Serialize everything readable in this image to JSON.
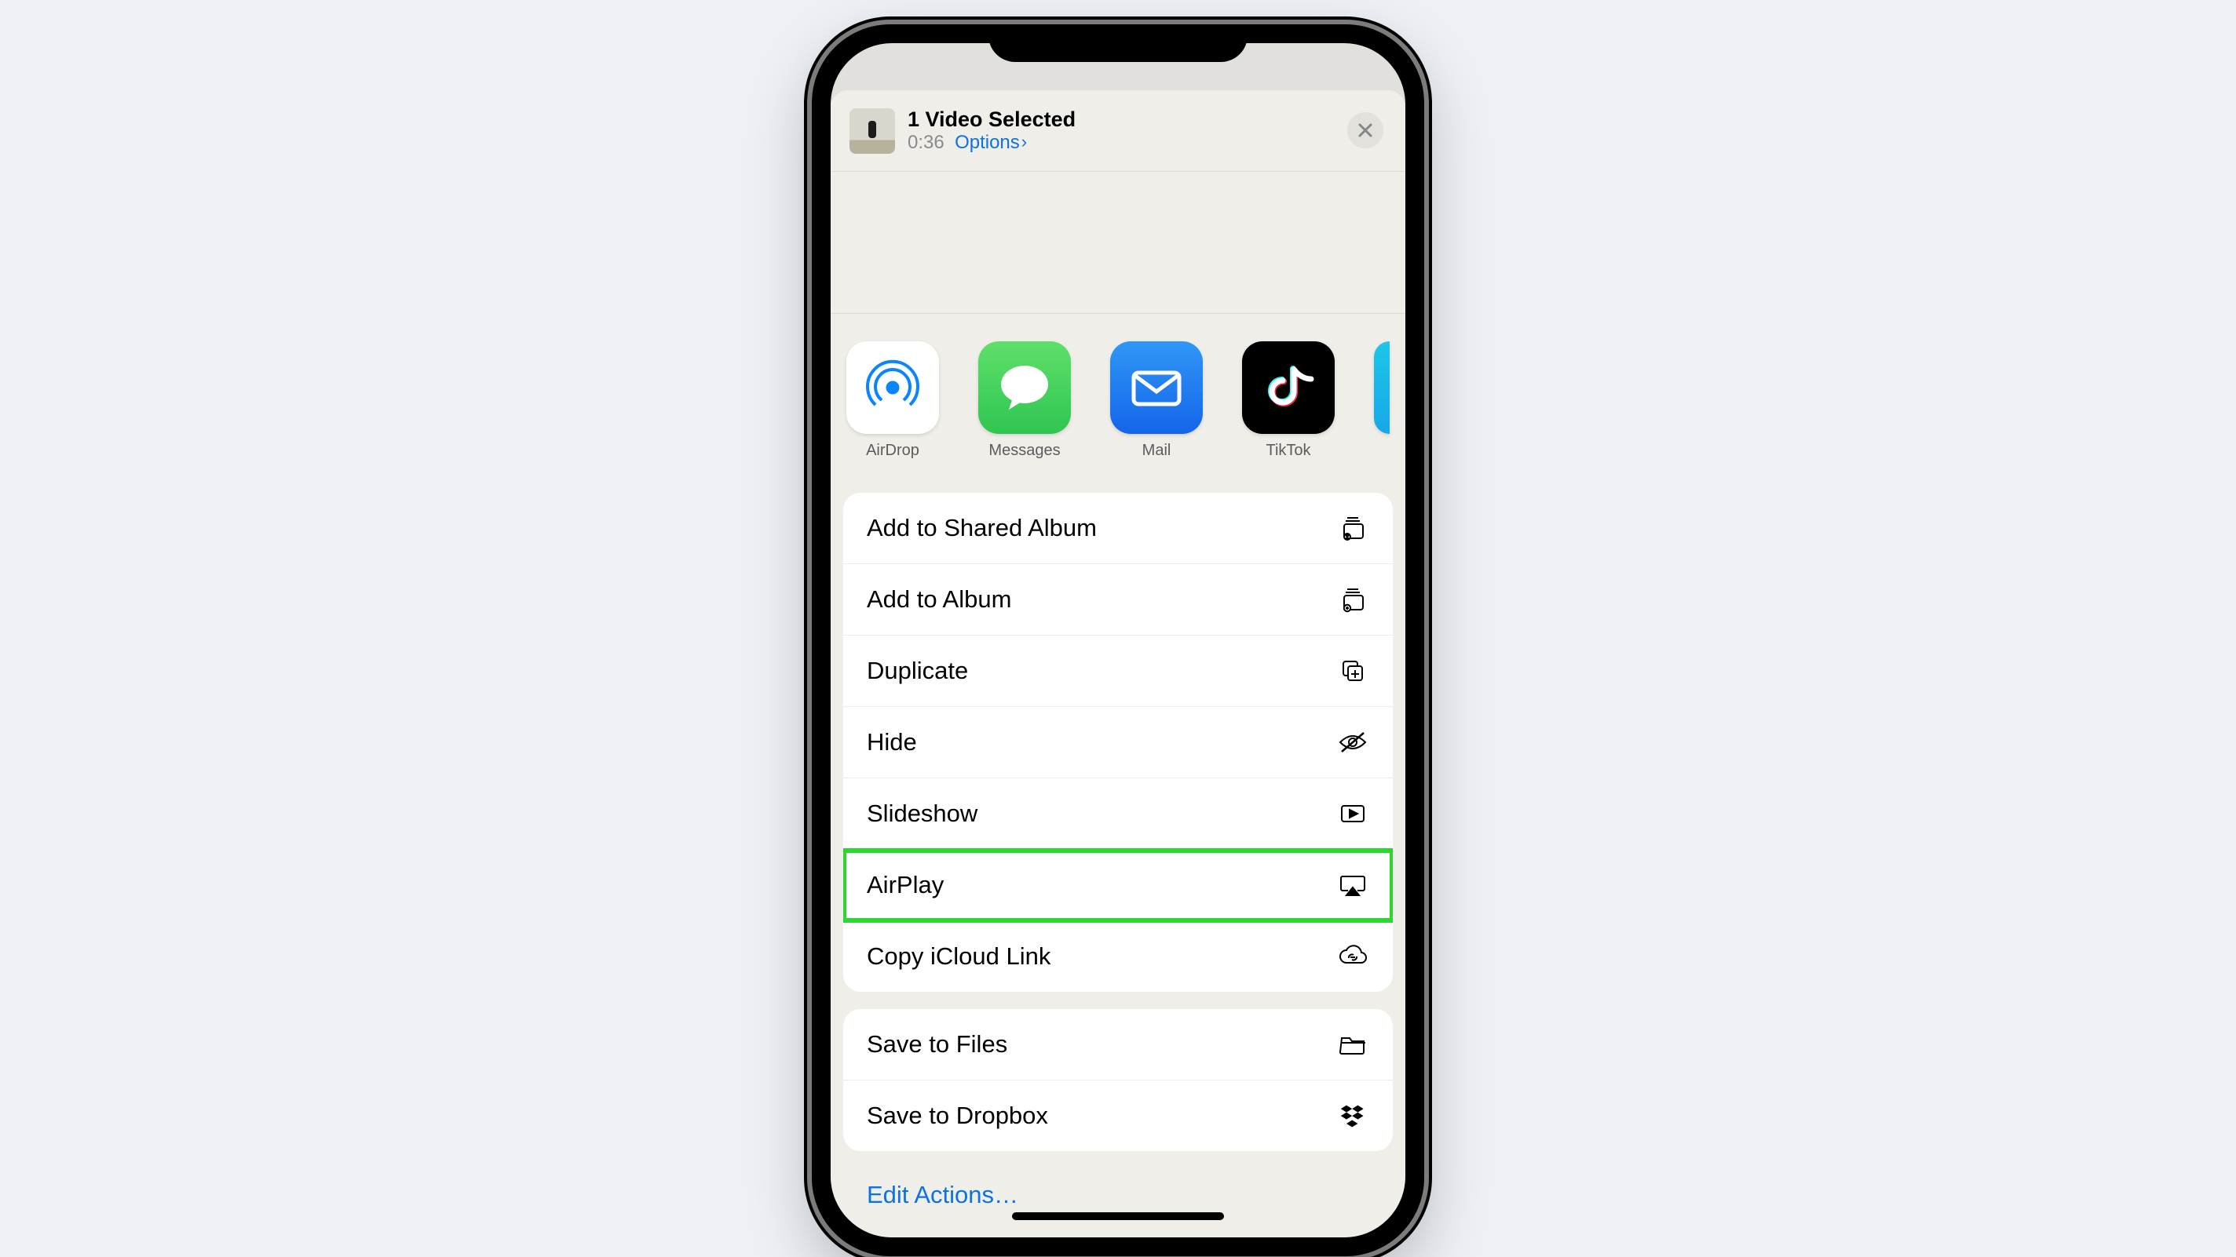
{
  "header": {
    "title": "1 Video Selected",
    "duration": "0:36",
    "options_label": "Options"
  },
  "apps": [
    {
      "label": "AirDrop"
    },
    {
      "label": "Messages"
    },
    {
      "label": "Mail"
    },
    {
      "label": "TikTok"
    }
  ],
  "actions_group1": [
    {
      "label": "Add to Shared Album"
    },
    {
      "label": "Add to Album"
    },
    {
      "label": "Duplicate"
    },
    {
      "label": "Hide"
    },
    {
      "label": "Slideshow"
    },
    {
      "label": "AirPlay"
    },
    {
      "label": "Copy iCloud Link"
    }
  ],
  "actions_group2": [
    {
      "label": "Save to Files"
    },
    {
      "label": "Save to Dropbox"
    }
  ],
  "edit_actions_label": "Edit Actions…"
}
